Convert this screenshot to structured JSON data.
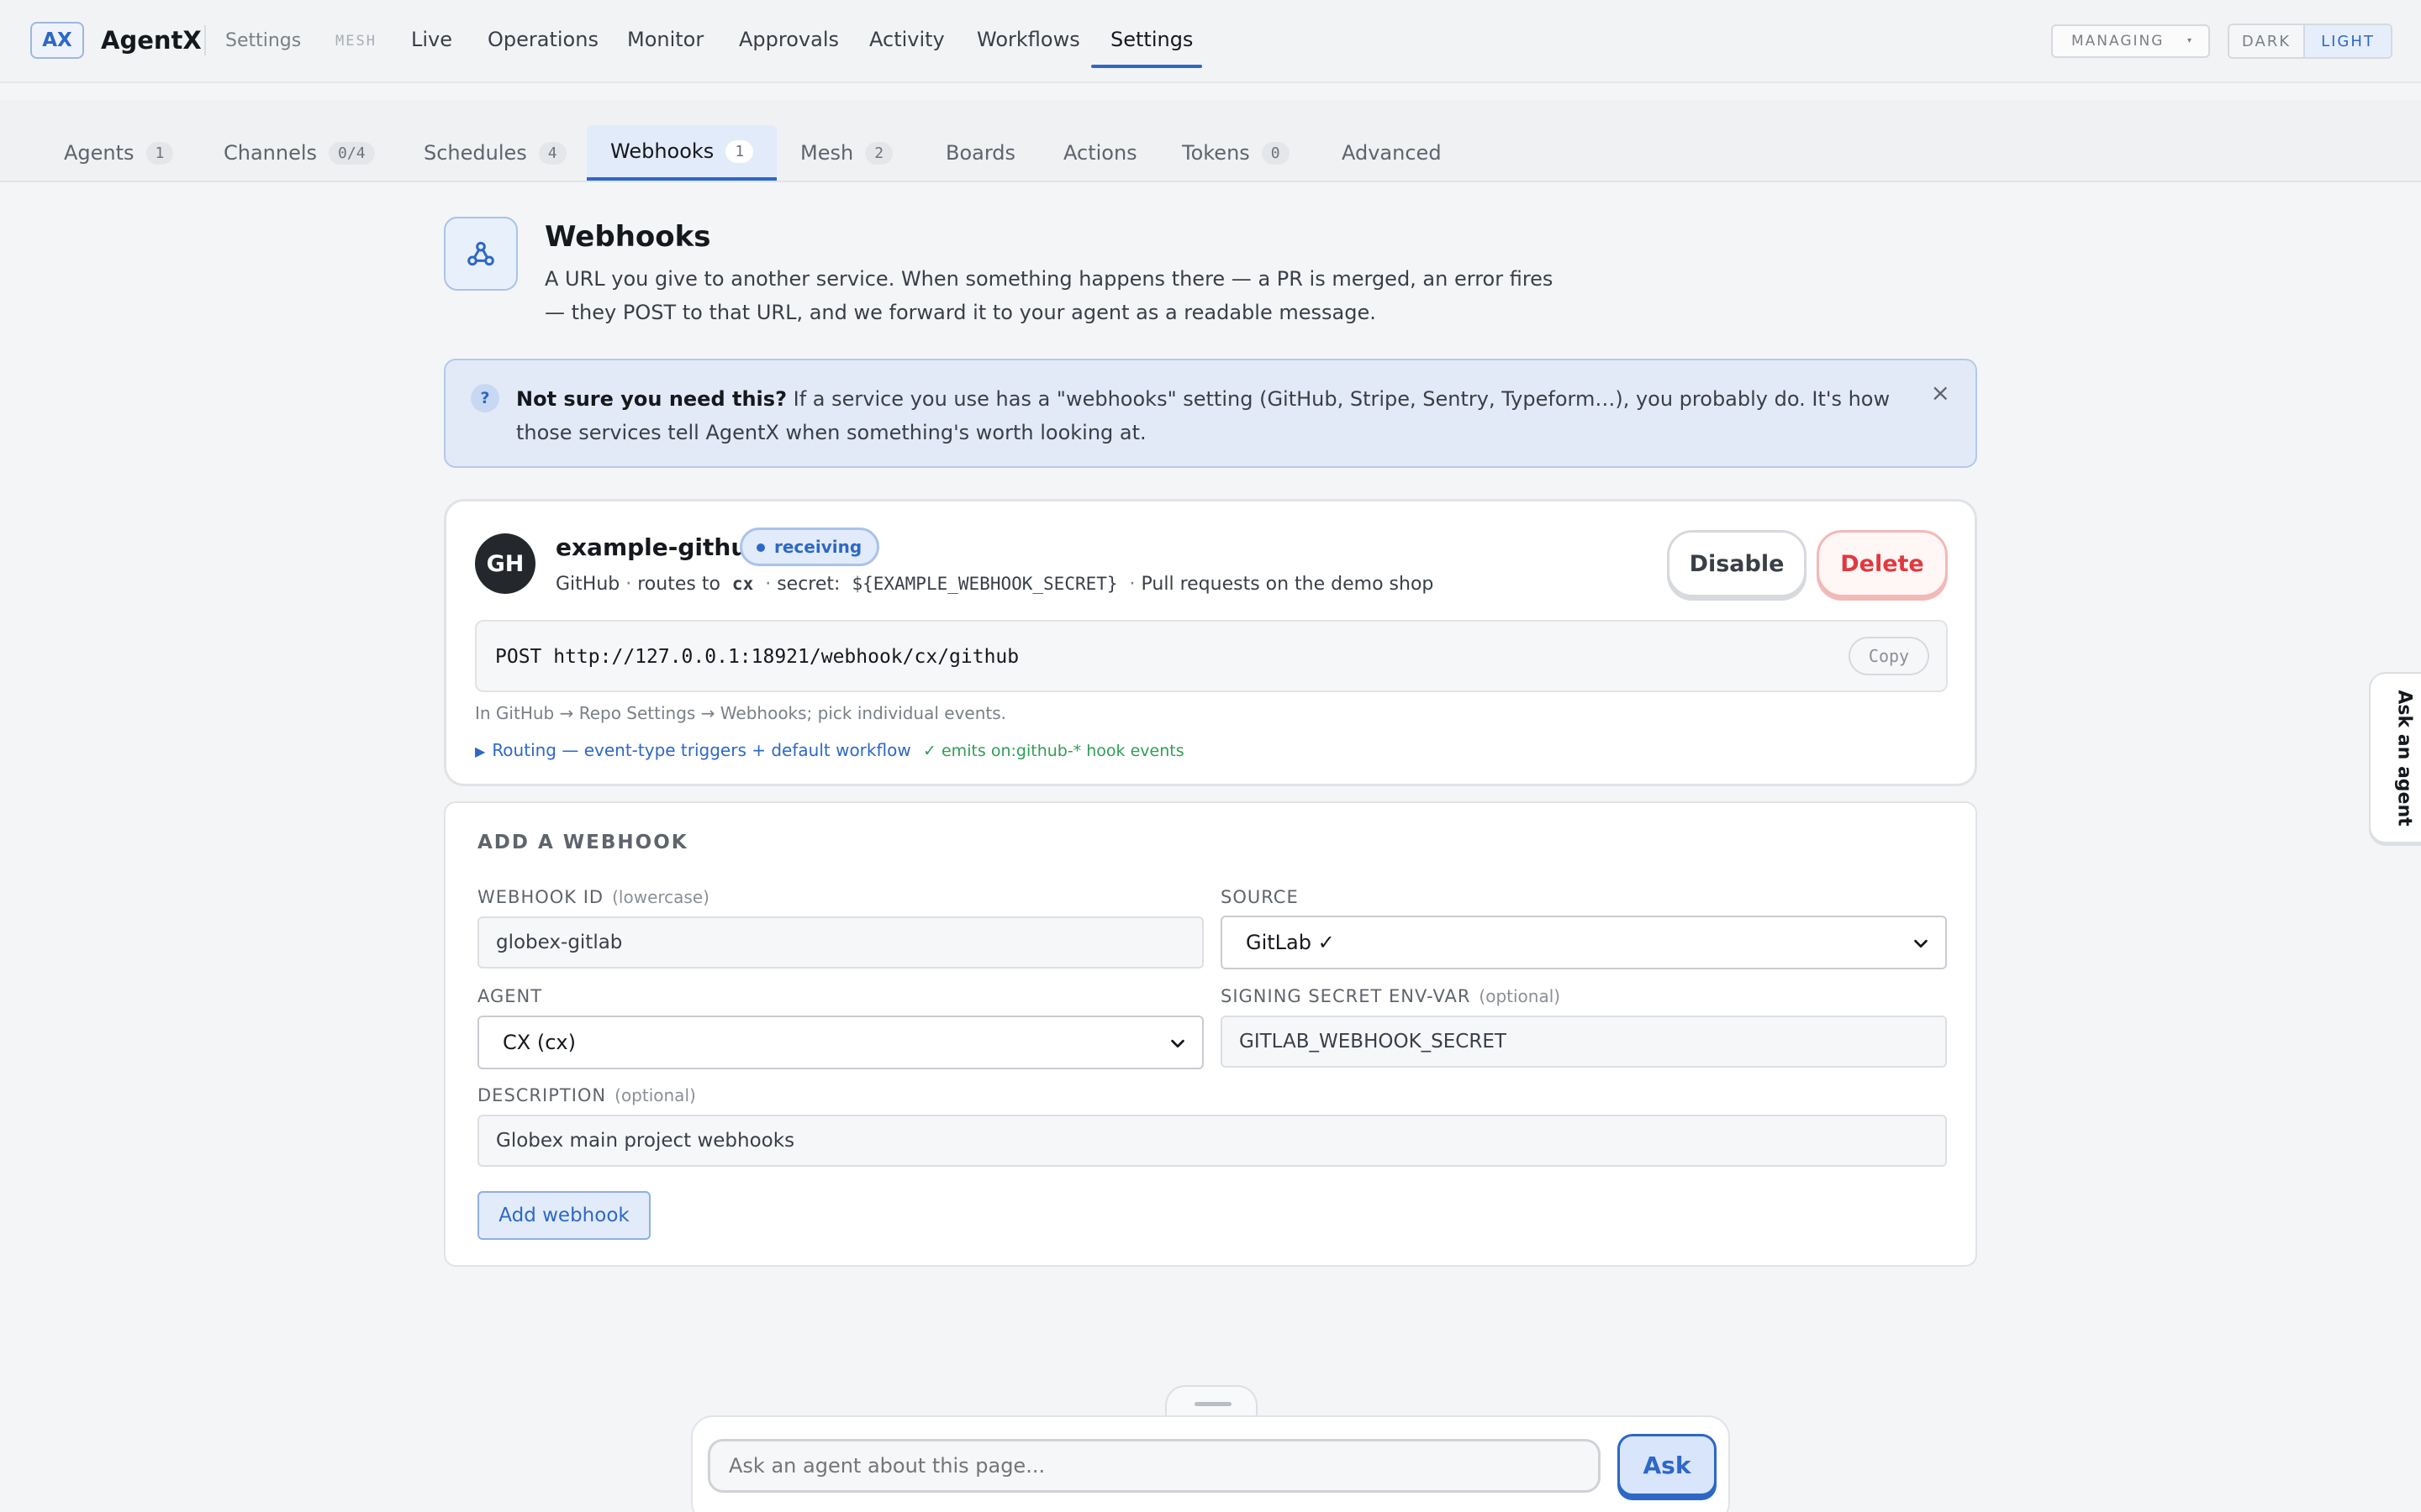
{
  "app": {
    "logo": "AX",
    "name": "AgentX",
    "breadcrumb": "Settings",
    "mesh_tag": "MESH"
  },
  "topnav": [
    "Live",
    "Operations",
    "Monitor",
    "Approvals",
    "Activity",
    "Workflows",
    "Settings"
  ],
  "topnav_active": "Settings",
  "header_controls": {
    "managing": "MANAGING",
    "theme_dark": "DARK",
    "theme_light": "LIGHT",
    "theme_active": "LIGHT"
  },
  "subtabs": [
    {
      "label": "Agents",
      "count": "1"
    },
    {
      "label": "Channels",
      "count": "0/4"
    },
    {
      "label": "Schedules",
      "count": "4"
    },
    {
      "label": "Webhooks",
      "count": "1"
    },
    {
      "label": "Mesh",
      "count": "2"
    },
    {
      "label": "Boards",
      "count": ""
    },
    {
      "label": "Actions",
      "count": ""
    },
    {
      "label": "Tokens",
      "count": "0"
    },
    {
      "label": "Advanced",
      "count": ""
    }
  ],
  "subtab_active": "Webhooks",
  "page": {
    "title": "Webhooks",
    "description": "A URL you give to another service. When something happens there — a PR is merged, an error fires — they POST to that URL, and we forward it to your agent as a readable message."
  },
  "banner": {
    "badge": "?",
    "lead": "Not sure you need this?",
    "text": " If a service you use has a \"webhooks\" setting (GitHub, Stripe, Sentry, Typeform…), you probably do. It's how those services tell AgentX when something's worth looking at.",
    "close": "×"
  },
  "webhook": {
    "avatar": "GH",
    "name": "example-github",
    "status": "receiving",
    "source": "GitHub",
    "routes_label": "routes to",
    "agent": "cx",
    "secret_label": "secret:",
    "secret": "${EXAMPLE_WEBHOOK_SECRET}",
    "description": "Pull requests on the demo shop",
    "meta_sep": "·",
    "disable_label": "Disable",
    "delete_label": "Delete",
    "endpoint": "POST http://127.0.0.1:18921/webhook/cx/github",
    "copy_label": "Copy",
    "hint": "In GitHub → Repo Settings → Webhooks; pick individual events.",
    "routing_link": "Routing — event-type triggers + default workflow",
    "routing_ok": "✓ emits on:github-* hook events"
  },
  "add_form": {
    "title": "ADD A WEBHOOK",
    "id_label": "WEBHOOK ID",
    "id_hint": "(lowercase)",
    "id_value": "globex-gitlab",
    "source_label": "SOURCE",
    "source_value": "GitLab ✓",
    "agent_label": "AGENT",
    "agent_value": "CX (cx)",
    "secret_label": "SIGNING SECRET ENV-VAR",
    "secret_hint": "(optional)",
    "secret_value": "GITLAB_WEBHOOK_SECRET",
    "desc_label": "DESCRIPTION",
    "desc_hint": "(optional)",
    "desc_value": "Globex main project webhooks",
    "submit_label": "Add webhook"
  },
  "ask": {
    "placeholder": "Ask an agent about this page...",
    "button": "Ask",
    "side_tab": "Ask an agent"
  },
  "colors": {
    "accent": "#2d68c6",
    "danger": "#e0393e",
    "success": "#2f9e55"
  }
}
